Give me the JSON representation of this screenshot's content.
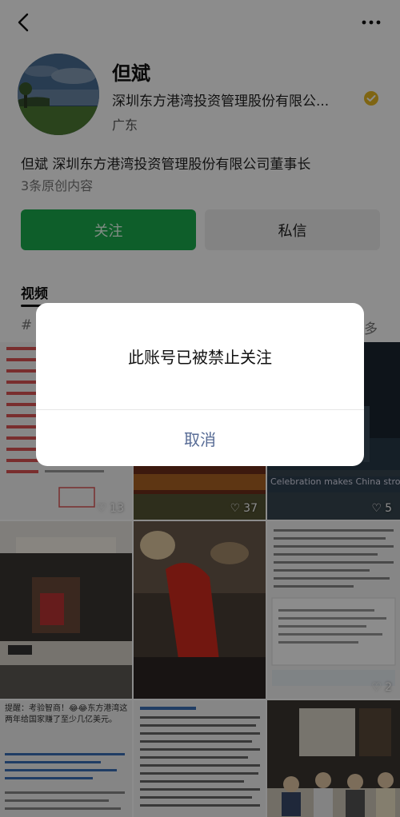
{
  "profile": {
    "name": "但斌",
    "company": "深圳东方港湾投资管理股份有限公...",
    "location": "广东",
    "bio": "但斌 深圳东方港湾投资管理股份有限公司董事长",
    "original_count": "3条原创内容",
    "follow_label": "关注",
    "message_label": "私信"
  },
  "tabs": {
    "video_label": "视频",
    "tag_left": "#",
    "tag_right": "多"
  },
  "grid": {
    "likes": [
      "13",
      "37",
      "5",
      "",
      "",
      "2",
      "",
      "",
      ""
    ],
    "cell3_text": "Celebration makes China strong",
    "cell6_text": "提醒：考验智商！😂😂东方港湾这两年给国家赚了至少几亿美元。"
  },
  "dialog": {
    "message": "此账号已被禁止关注",
    "cancel_label": "取消"
  },
  "colors": {
    "follow_green": "#1aac4d",
    "cancel_blue": "#576b95",
    "verify_gold": "#e8b923"
  }
}
